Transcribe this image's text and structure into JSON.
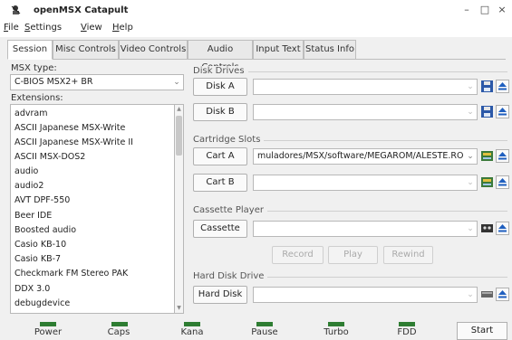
{
  "window": {
    "title": "openMSX Catapult"
  },
  "menu": [
    {
      "ul": "F",
      "rest": "ile"
    },
    {
      "ul": "S",
      "rest": "ettings"
    },
    {
      "ul": "V",
      "rest": "iew"
    },
    {
      "ul": "H",
      "rest": "elp"
    }
  ],
  "tabs": [
    "Session",
    "Misc Controls",
    "Video Controls",
    "Audio Controls",
    "Input Text",
    "Status Info"
  ],
  "session": {
    "msx_type_label": "MSX type:",
    "msx_type_value": "C-BIOS MSX2+ BR",
    "extensions_label": "Extensions:",
    "extensions": [
      "advram",
      "ASCII Japanese MSX-Write",
      "ASCII Japanese MSX-Write II",
      "ASCII MSX-DOS2",
      "audio",
      "audio2",
      "AVT DPF-550",
      "Beer IDE",
      "Boosted audio",
      "Casio KB-10",
      "Casio KB-7",
      "Checkmark FM Stereo PAK",
      "DDX 3.0",
      "debugdevice"
    ]
  },
  "disk_drives": {
    "title": "Disk Drives",
    "disk_a": {
      "label": "Disk A",
      "value": ""
    },
    "disk_b": {
      "label": "Disk B",
      "value": ""
    }
  },
  "cartridge_slots": {
    "title": "Cartridge Slots",
    "cart_a": {
      "label": "Cart A",
      "value": "muladores/MSX/software/MEGAROM/ALESTE.ROM"
    },
    "cart_b": {
      "label": "Cart B",
      "value": ""
    }
  },
  "cassette_player": {
    "title": "Cassette Player",
    "cassette": {
      "label": "Cassette",
      "value": ""
    },
    "record": "Record",
    "play": "Play",
    "rewind": "Rewind"
  },
  "hard_disk": {
    "title": "Hard Disk Drive",
    "hd": {
      "label": "Hard Disk",
      "value": ""
    }
  },
  "status": {
    "leds": [
      "Power",
      "Caps",
      "Kana",
      "Pause",
      "Turbo",
      "FDD"
    ],
    "start": "Start"
  },
  "colors": {
    "led_on": "#2e7d32",
    "eject_blue": "#1f5fbf"
  },
  "icons": [
    "openmsx-icon",
    "minimize-icon",
    "maximize-icon",
    "close-icon",
    "save-disk-icon",
    "eject-icon",
    "cartridge-icon",
    "cassette-icon",
    "harddisk-icon"
  ]
}
